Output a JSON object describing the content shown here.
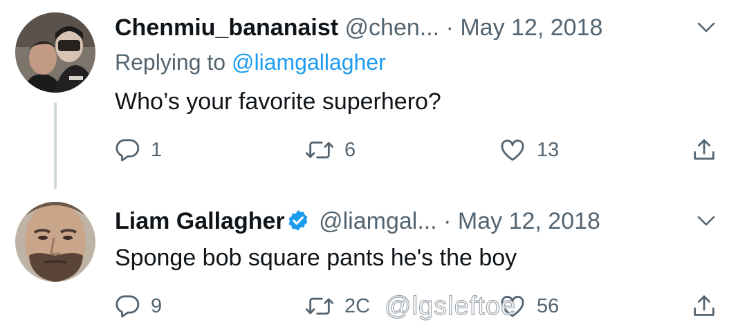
{
  "tweets": [
    {
      "author": {
        "display_name": "Chenmiu_bananaist",
        "handle": "@chen...",
        "verified": false
      },
      "separator": "·",
      "date": "May 12, 2018",
      "replying_to": {
        "prefix": "Replying to",
        "mention": "@liamgallagher"
      },
      "text": "Who’s your favorite superhero?",
      "stats": {
        "replies": "1",
        "retweets": "6",
        "likes": "13"
      }
    },
    {
      "author": {
        "display_name": "Liam Gallagher",
        "handle": "@liamgal...",
        "verified": true
      },
      "separator": "·",
      "date": "May 12, 2018",
      "text": "Sponge bob square pants he's the boy",
      "stats": {
        "replies": "9",
        "retweets": "2C",
        "likes": "56"
      }
    }
  ],
  "watermark": "@lgsleftoe",
  "colors": {
    "primary_text": "#0f1419",
    "secondary_text": "#536471",
    "link": "#1d9bf0",
    "verified_badge": "#1d9bf0",
    "thread_line": "#cfd9de"
  },
  "icons": [
    "reply-icon",
    "retweet-icon",
    "like-icon",
    "share-icon",
    "chevron-down-icon",
    "verified-badge-icon"
  ]
}
